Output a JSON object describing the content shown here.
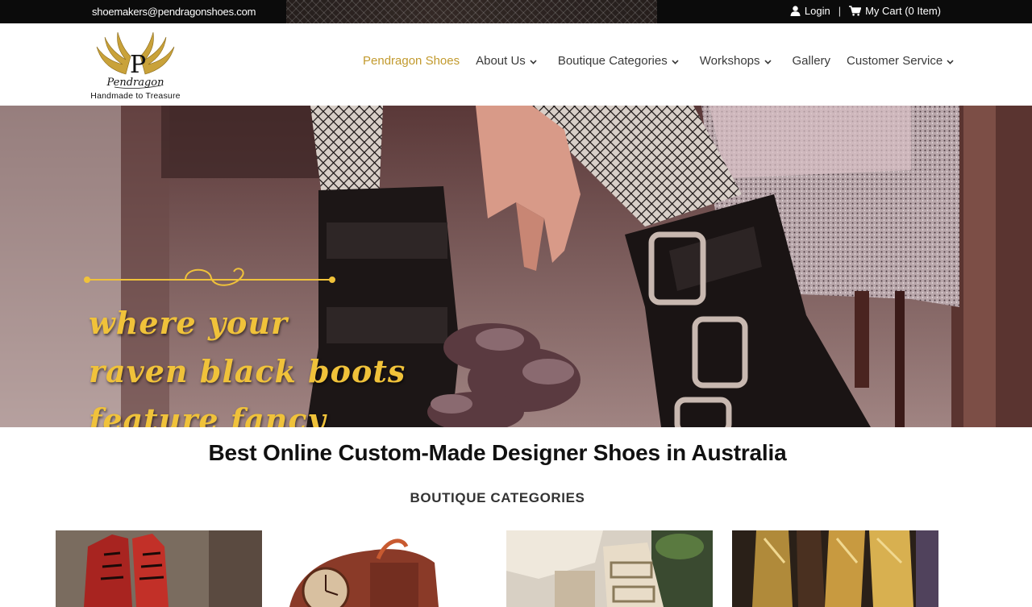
{
  "topbar": {
    "email": "shoemakers@pendragonshoes.com",
    "login_label": "Login",
    "cart_label": "My Cart (0 Item)",
    "user_icon": "user-icon",
    "cart_icon": "cart-icon"
  },
  "logo": {
    "letter": "P",
    "script_name": "Pendragon",
    "tagline": "Handmade to Treasure",
    "gold": "#c9a23a"
  },
  "nav": {
    "items": [
      {
        "label": "Pendragon Shoes",
        "dropdown": false,
        "active": true
      },
      {
        "label": "About Us",
        "dropdown": true,
        "active": false
      },
      {
        "label": "Boutique Categories",
        "dropdown": true,
        "active": false
      },
      {
        "label": "Workshops",
        "dropdown": true,
        "active": false
      },
      {
        "label": "Gallery",
        "dropdown": false,
        "active": false
      },
      {
        "label": "Customer Service",
        "dropdown": true,
        "active": false
      }
    ],
    "active_color": "#c29a2e",
    "text_color": "#3a3a3a"
  },
  "hero": {
    "lines": [
      "where your",
      "raven black boots",
      "feature fancy"
    ],
    "text_color": "#f0c23a"
  },
  "main": {
    "title": "Best Online Custom-Made Designer Shoes in Australia",
    "section_title": "BOUTIQUE CATEGORIES"
  },
  "categories": [
    {
      "name": "red-lace-up-boots-image"
    },
    {
      "name": "clock-print-shoe-image"
    },
    {
      "name": "buckled-ivory-boot-image"
    },
    {
      "name": "gold-metallic-boots-image"
    }
  ]
}
